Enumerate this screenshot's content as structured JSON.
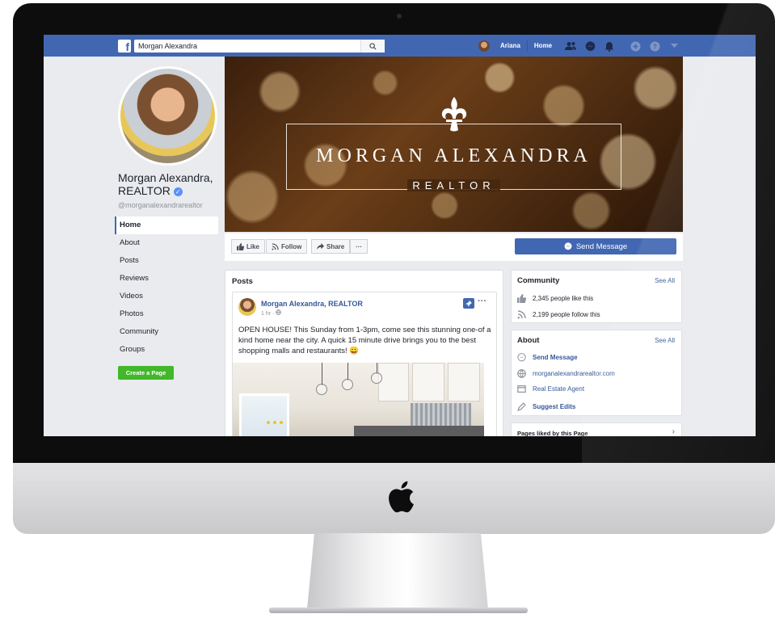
{
  "topbar": {
    "search_value": "Morgan Alexandra",
    "user_name": "Ariana",
    "home_label": "Home"
  },
  "profile": {
    "name": "Morgan Alexandra, REALTOR",
    "handle": "@morganalexandrarealtor"
  },
  "left_nav": {
    "items": [
      "Home",
      "About",
      "Posts",
      "Reviews",
      "Videos",
      "Photos",
      "Community",
      "Groups"
    ],
    "create_page_label": "Create a Page"
  },
  "cover": {
    "title": "MORGAN ALEXANDRA",
    "subtitle": "REALTOR"
  },
  "actions": {
    "like_label": "Like",
    "follow_label": "Follow",
    "share_label": "Share",
    "more_label": "···",
    "send_message_label": "Send Message"
  },
  "posts": {
    "heading": "Posts",
    "post": {
      "author": "Morgan Alexandra, REALTOR",
      "meta": "1 hr · ",
      "text": "OPEN HOUSE! This Sunday from 1-3pm, come see this stunning one-of a kind home near the city. A quick 15 minute drive brings you to the best shopping malls and restaurants! 😀"
    }
  },
  "community": {
    "title": "Community",
    "see_all": "See All",
    "likes_text": "2,345 people like this",
    "follows_text": "2,199 people follow this"
  },
  "about": {
    "title": "About",
    "see_all": "See All",
    "send_message": "Send Message",
    "website": "morganalexandrarealtor.com",
    "category": "Real Estate Agent",
    "suggest_edits": "Suggest Edits"
  },
  "pages_liked": {
    "title": "Pages liked by this Page"
  },
  "colors": {
    "facebook_blue": "#4267b2",
    "link_blue": "#365899",
    "create_green": "#42b72a",
    "background": "#e9ebee"
  },
  "icons": [
    "facebook-logo-icon",
    "search-icon",
    "friends-icon",
    "messenger-icon",
    "notifications-icon",
    "help-icon",
    "dropdown-icon",
    "verified-icon",
    "like-icon",
    "follow-icon",
    "share-icon",
    "pin-icon",
    "globe-icon",
    "apple-logo-icon"
  ]
}
